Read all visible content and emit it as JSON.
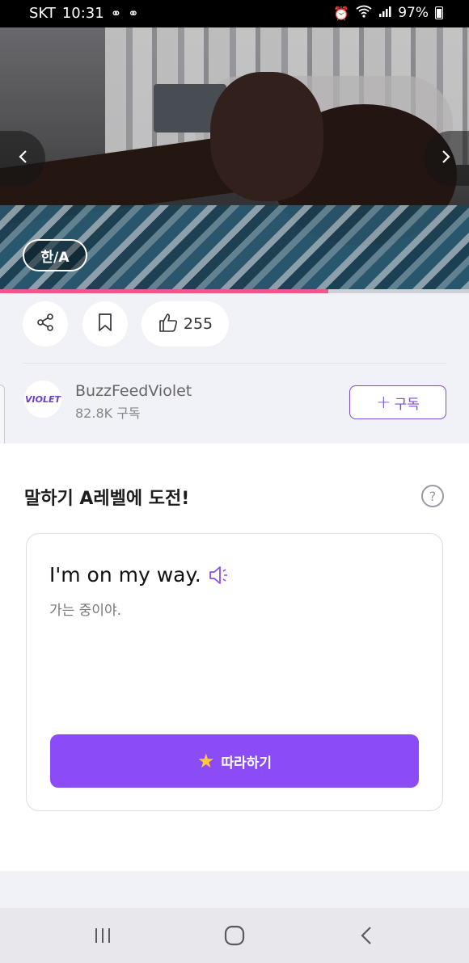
{
  "status_bar": {
    "carrier": "SKT",
    "time": "10:31",
    "battery": "97%"
  },
  "video": {
    "subtitle_toggle": "한/A",
    "prev_icon": "chevron-left-icon",
    "next_icon": "chevron-right-icon",
    "progress": 0.7
  },
  "actions": {
    "like_count": "255"
  },
  "channel": {
    "logo_text": "VIOLET",
    "name": "BuzzFeedViolet",
    "subscribers": "82.8K 구독",
    "subscribe_label": "구독"
  },
  "challenge": {
    "title": "말하기 A레벨에 도전!",
    "sentence": "I'm on my way.",
    "translation": "가는 중이야.",
    "follow_label": "따라하기"
  },
  "colors": {
    "accent": "#8b4cf7",
    "progress": "#ea5a8c"
  }
}
